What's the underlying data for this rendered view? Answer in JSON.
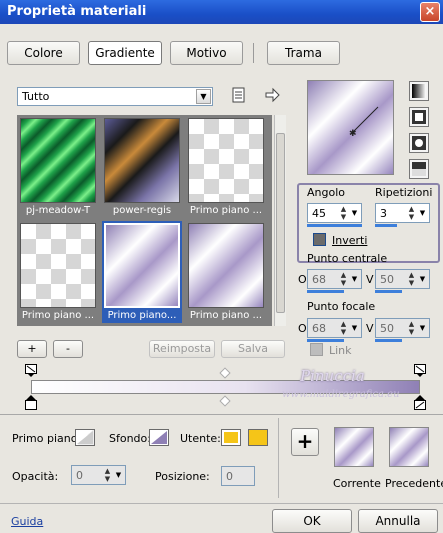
{
  "window": {
    "title": "Proprietà materiali",
    "close_label": "×"
  },
  "tabs": [
    {
      "label": "Colore"
    },
    {
      "label": "Gradiente"
    },
    {
      "label": "Motivo"
    },
    {
      "label": "Trama"
    }
  ],
  "category_select": {
    "value": "Tutto"
  },
  "gallery": {
    "items": [
      {
        "caption": "pj-meadow-T"
      },
      {
        "caption": "power-regis"
      },
      {
        "caption": "Primo piano ..."
      },
      {
        "caption": "Primo piano ..."
      },
      {
        "caption": "Primo piano..."
      },
      {
        "caption": "Primo piano ..."
      }
    ]
  },
  "buttons": {
    "add": "+",
    "remove": "-",
    "reset": "Reimposta",
    "save": "Salva"
  },
  "angle": {
    "label": "Angolo",
    "value": "45"
  },
  "repeats": {
    "label": "Ripetizioni",
    "value": "3"
  },
  "invert": {
    "label": "Inverti"
  },
  "center_point": {
    "label": "Punto centrale",
    "o_label": "O",
    "v_label": "V",
    "o_value": "68",
    "v_value": "50"
  },
  "focal_point": {
    "label": "Punto focale",
    "o_label": "O",
    "v_label": "V",
    "o_value": "68",
    "v_value": "50"
  },
  "link": {
    "label": "Link"
  },
  "watermark": {
    "line1": "Pinuccia",
    "line2": "www.maidiregrafica.eu"
  },
  "bottom": {
    "foreground_label": "Primo piano:",
    "background_label": "Sfondo:",
    "user_label": "Utente:",
    "opacity_label": "Opacità:",
    "opacity_value": "0",
    "position_label": "Posizione:",
    "position_value": "0",
    "add_button": "+",
    "current_label": "Corrente",
    "previous_label": "Precedente"
  },
  "footer": {
    "help": "Guida",
    "ok": "OK",
    "cancel": "Annulla"
  },
  "colors": {
    "accent": "#8f80b5",
    "user_swatch": "#f5c518",
    "selection": "#2d5eb8"
  }
}
